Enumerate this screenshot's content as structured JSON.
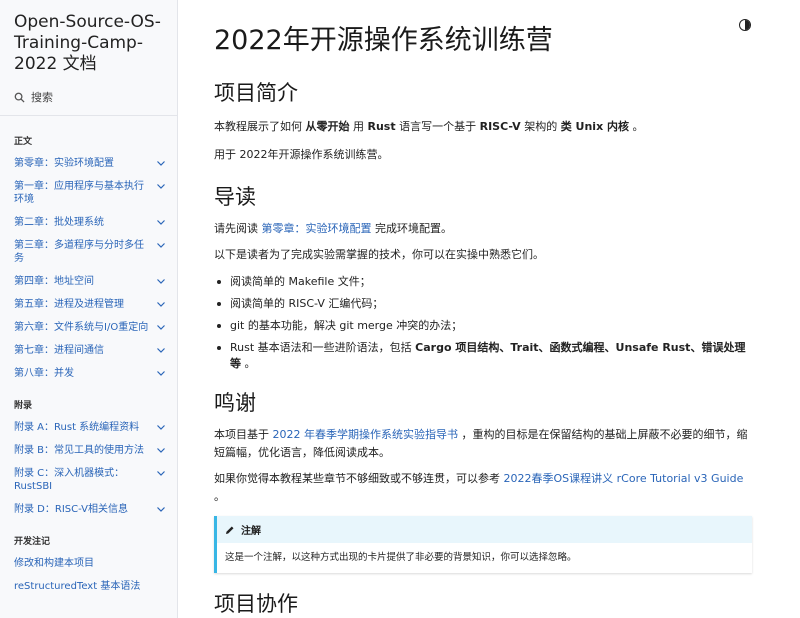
{
  "sidebar": {
    "brand": "Open-Source-OS-Training-Camp-2022 文档",
    "search_label": "搜索",
    "sections": [
      {
        "caption": "正文",
        "items": [
          {
            "label": "第零章：实验环境配置"
          },
          {
            "label": "第一章：应用程序与基本执行环境"
          },
          {
            "label": "第二章：批处理系统"
          },
          {
            "label": "第三章：多道程序与分时多任务"
          },
          {
            "label": "第四章：地址空间"
          },
          {
            "label": "第五章：进程及进程管理"
          },
          {
            "label": "第六章：文件系统与I/O重定向"
          },
          {
            "label": "第七章：进程间通信"
          },
          {
            "label": "第八章：并发"
          }
        ]
      },
      {
        "caption": "附录",
        "items": [
          {
            "label": "附录 A：Rust 系统编程资料"
          },
          {
            "label": "附录 B：常见工具的使用方法"
          },
          {
            "label": "附录 C：深入机器模式：RustSBI"
          },
          {
            "label": "附录 D：RISC-V相关信息"
          }
        ]
      },
      {
        "caption": "开发注记",
        "items": [
          {
            "label": "修改和构建本项目"
          },
          {
            "label": "reStructuredText 基本语法"
          }
        ]
      }
    ]
  },
  "page": {
    "title": "2022年开源操作系统训练营",
    "intro": {
      "heading": "项目简介",
      "p1": {
        "t1": "本教程展示了如何 ",
        "b1": "从零开始",
        "t2": " 用 ",
        "b2": "Rust",
        "t3": " 语言写一个基于 ",
        "b3": "RISC-V",
        "t4": " 架构的 ",
        "b4": "类 Unix 内核",
        "t5": " 。"
      },
      "p2": "用于 2022年开源操作系统训练营。"
    },
    "guide": {
      "heading": "导读",
      "p1_pre": "请先阅读 ",
      "p1_link": "第零章：实验环境配置",
      "p1_post": " 完成环境配置。",
      "p2": "以下是读者为了完成实验需掌握的技术，你可以在实操中熟悉它们。",
      "bullets": [
        "阅读简单的 Makefile 文件；",
        "阅读简单的 RISC-V 汇编代码；",
        "git 的基本功能，解决 git merge 冲突的办法；"
      ],
      "bullet4": {
        "t1": "Rust 基本语法和一些进阶语法，包括 ",
        "b1": "Cargo 项目结构、Trait、函数式编程、Unsafe Rust、错误处理等",
        "t2": " 。"
      }
    },
    "thanks": {
      "heading": "鸣谢",
      "p1_pre": "本项目基于 ",
      "p1_link": "2022 年春季学期操作系统实验指导书",
      "p1_post": " ，重构的目标是在保留结构的基础上屏蔽不必要的细节，缩短篇幅，优化语言，降低阅读成本。",
      "p2_pre": "如果你觉得本教程某些章节不够细致或不够连贯，可以参考 ",
      "p2_link": "2022春季OS课程讲义 rCore Tutorial v3 Guide",
      "p2_post": " 。",
      "note_title": "注解",
      "note_body": "这是一个注解，以这种方式出现的卡片提供了非必要的背景知识，你可以选择忽略。"
    },
    "collab": {
      "heading": "项目协作"
    }
  },
  "colors": {
    "link": "#2a65b8",
    "note_accent": "#38b6e5",
    "note_header_bg": "#e8f6fc",
    "sidebar_bg": "#f8f9fb"
  },
  "icons": {
    "search": "search-icon",
    "chevron": "chevron-down-icon",
    "pencil": "pencil-icon",
    "theme": "theme-toggle-icon"
  }
}
